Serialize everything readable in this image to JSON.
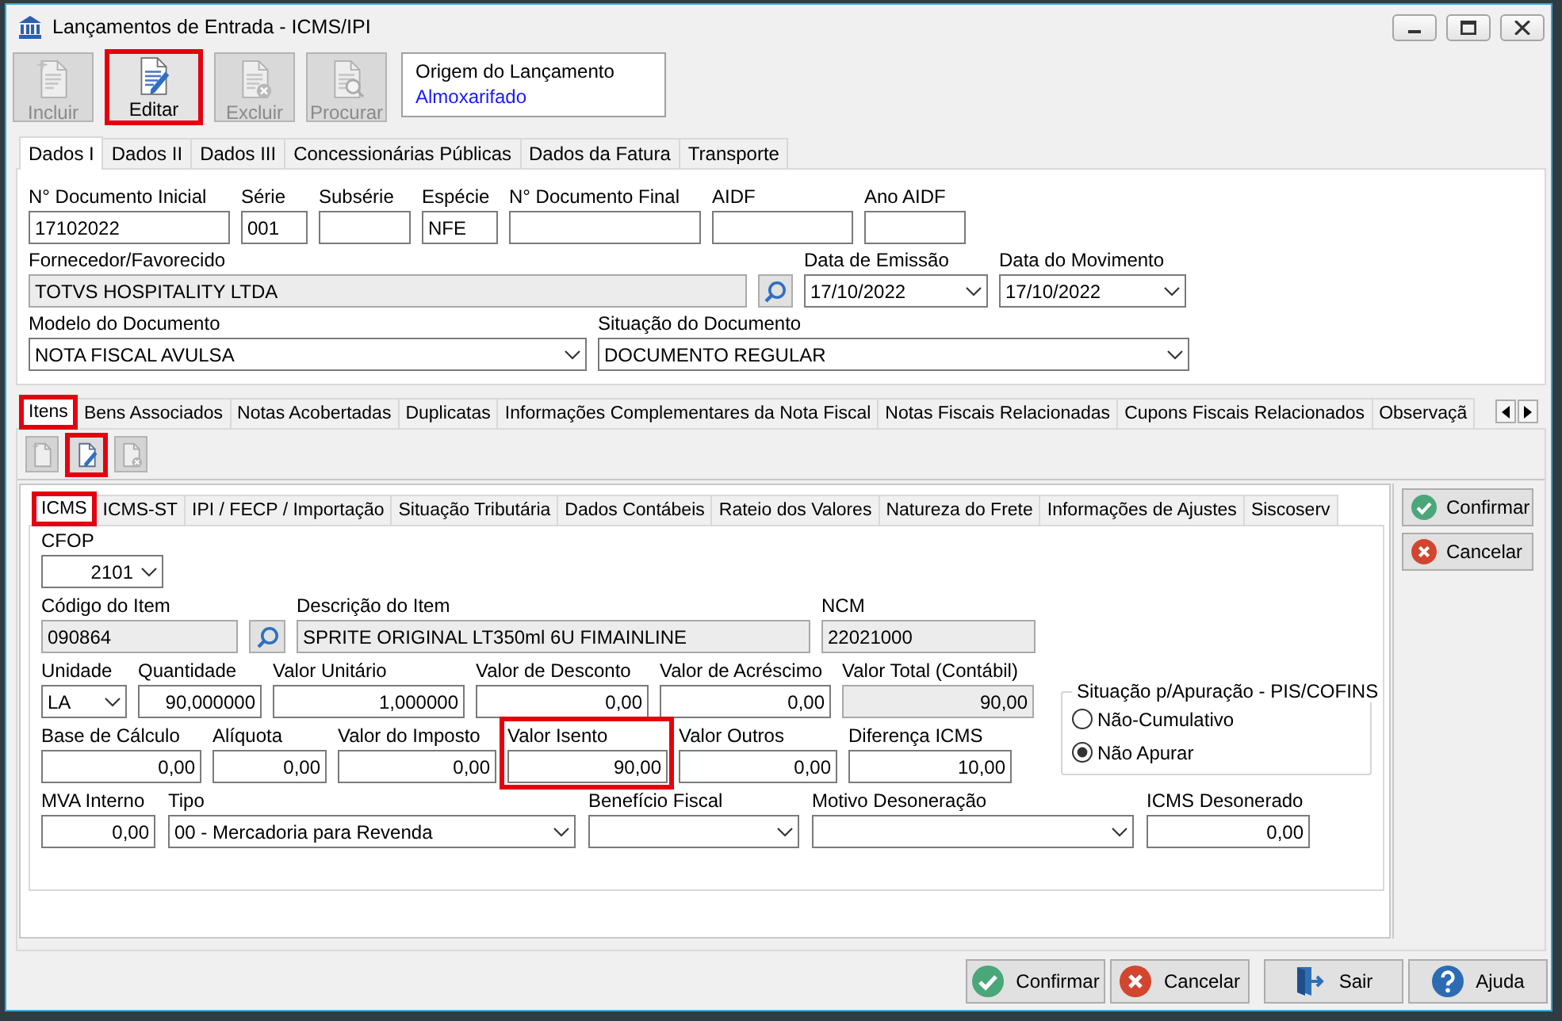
{
  "window": {
    "title": "Lançamentos de Entrada - ICMS/IPI"
  },
  "toolbar": [
    {
      "kind": "new",
      "label": "Incluir",
      "disabled": true,
      "highlighted": false
    },
    {
      "kind": "edit",
      "label": "Editar",
      "disabled": false,
      "highlighted": true
    },
    {
      "kind": "delete",
      "label": "Excluir",
      "disabled": true,
      "highlighted": false
    },
    {
      "kind": "search",
      "label": "Procurar",
      "disabled": true,
      "highlighted": false
    }
  ],
  "origin": {
    "label": "Origem do Lançamento",
    "value": "Almoxarifado"
  },
  "main_tabs": [
    {
      "label": "Dados I",
      "selected": true
    },
    {
      "label": "Dados II",
      "selected": false
    },
    {
      "label": "Dados III",
      "selected": false
    },
    {
      "label": "Concessionárias Públicas",
      "selected": false
    },
    {
      "label": "Dados da Fatura",
      "selected": false
    },
    {
      "label": "Transporte",
      "selected": false
    }
  ],
  "document_rows": [
    [
      {
        "kind": "text",
        "label": "N° Documento Inicial",
        "value": "17102022",
        "read_only": false
      },
      {
        "kind": "text",
        "label": "Série",
        "value": "001",
        "read_only": false
      },
      {
        "kind": "text",
        "label": "Subsérie",
        "read_only": false
      },
      {
        "kind": "text",
        "label": "Espécie",
        "value": "NFE",
        "read_only": false
      },
      {
        "kind": "text",
        "label": "N° Documento Final",
        "read_only": false
      },
      {
        "kind": "text",
        "label": "AIDF",
        "read_only": false
      },
      {
        "kind": "text",
        "label": "Ano AIDF",
        "read_only": false
      }
    ],
    [
      {
        "kind": "text",
        "label": "Fornecedor/Favorecido",
        "value": "TOTVS HOSPITALITY LTDA",
        "read_only": true
      },
      {
        "kind": "lookup"
      },
      {
        "kind": "combo",
        "label": "Data de Emissão",
        "value": "17/10/2022",
        "read_only": false
      },
      {
        "kind": "combo",
        "label": "Data do Movimento",
        "value": "17/10/2022",
        "read_only": false
      }
    ],
    [
      {
        "kind": "combo",
        "label": "Modelo do Documento",
        "value": "NOTA FISCAL AVULSA",
        "read_only": false
      },
      {
        "kind": "combo",
        "label": "Situação do Documento",
        "value": "DOCUMENTO REGULAR",
        "read_only": false
      }
    ]
  ],
  "item_tabs": [
    {
      "label": "Itens",
      "selected": true,
      "highlighted": true
    },
    {
      "label": "Bens Associados",
      "selected": false,
      "highlighted": false
    },
    {
      "label": "Notas Acobertadas",
      "selected": false,
      "highlighted": false
    },
    {
      "label": "Duplicatas",
      "selected": false,
      "highlighted": false
    },
    {
      "label": "Informações Complementares da Nota Fiscal",
      "selected": false,
      "highlighted": false
    },
    {
      "label": "Notas Fiscais Relacionadas",
      "selected": false,
      "highlighted": false
    },
    {
      "label": "Cupons Fiscais Relacionados",
      "selected": false,
      "highlighted": false
    },
    {
      "label": "Observaçã",
      "selected": false,
      "highlighted": false
    }
  ],
  "item_toolbar": [
    {
      "kind": "new",
      "disabled": true,
      "highlighted": false
    },
    {
      "kind": "edit",
      "disabled": false,
      "highlighted": true
    },
    {
      "kind": "delete",
      "disabled": true,
      "highlighted": false
    }
  ],
  "detail_tabs": [
    {
      "label": "ICMS",
      "selected": true,
      "highlighted": true
    },
    {
      "label": "ICMS-ST",
      "selected": false,
      "highlighted": false
    },
    {
      "label": "IPI / FECP / Importação",
      "selected": false,
      "highlighted": false
    },
    {
      "label": "Situação Tributária",
      "selected": false,
      "highlighted": false
    },
    {
      "label": "Dados Contábeis",
      "selected": false,
      "highlighted": false
    },
    {
      "label": "Rateio dos Valores",
      "selected": false,
      "highlighted": false
    },
    {
      "label": "Natureza do Frete",
      "selected": false,
      "highlighted": false
    },
    {
      "label": "Informações de Ajustes",
      "selected": false,
      "highlighted": false
    },
    {
      "label": "Siscoserv",
      "selected": false,
      "highlighted": false
    }
  ],
  "icms_rows": [
    [
      {
        "kind": "numcombo",
        "label": "CFOP",
        "value": "2101",
        "read_only": false,
        "highlighted": false
      }
    ],
    [
      {
        "kind": "text",
        "label": "Código do Item",
        "value": "090864",
        "read_only": true,
        "highlighted": false
      },
      {
        "kind": "lookup"
      },
      {
        "kind": "text",
        "label": "Descrição do Item",
        "value": "SPRITE ORIGINAL LT350ml 6U FIMAINLINE",
        "read_only": true,
        "highlighted": false
      },
      {
        "kind": "text",
        "label": "NCM",
        "value": "22021000",
        "read_only": true,
        "highlighted": false
      }
    ],
    [
      {
        "kind": "combo",
        "label": "Unidade",
        "value": "LA",
        "read_only": false,
        "highlighted": false
      },
      {
        "kind": "number",
        "label": "Quantidade",
        "value": "90,000000",
        "read_only": false,
        "highlighted": false
      },
      {
        "kind": "number",
        "label": "Valor Unitário",
        "value": "1,000000",
        "read_only": false,
        "highlighted": false
      },
      {
        "kind": "number",
        "label": "Valor de Desconto",
        "value": "0,00",
        "read_only": false,
        "highlighted": false
      },
      {
        "kind": "number",
        "label": "Valor de Acréscimo",
        "value": "0,00",
        "read_only": false,
        "highlighted": false
      },
      {
        "kind": "number",
        "label": "Valor Total (Contábil)",
        "value": "90,00",
        "read_only": true,
        "highlighted": false
      }
    ],
    [
      {
        "kind": "number",
        "label": "Base de Cálculo",
        "value": "0,00",
        "read_only": false,
        "highlighted": false
      },
      {
        "kind": "number",
        "label": "Alíquota",
        "value": "0,00",
        "read_only": false,
        "highlighted": false
      },
      {
        "kind": "number",
        "label": "Valor do Imposto",
        "value": "0,00",
        "read_only": false,
        "highlighted": false
      },
      {
        "kind": "number",
        "label": "Valor Isento",
        "value": "90,00",
        "read_only": false,
        "highlighted": true
      },
      {
        "kind": "number",
        "label": "Valor Outros",
        "value": "0,00",
        "read_only": false,
        "highlighted": false
      },
      {
        "kind": "number",
        "label": "Diferença ICMS",
        "value": "10,00",
        "read_only": false,
        "highlighted": false
      }
    ],
    [
      {
        "kind": "number",
        "label": "MVA Interno",
        "value": "0,00",
        "read_only": false,
        "highlighted": false
      },
      {
        "kind": "combo",
        "label": "Tipo",
        "value": "00 - Mercadoria para Revenda",
        "read_only": false,
        "highlighted": false
      },
      {
        "kind": "combo",
        "label": "Benefício Fiscal",
        "read_only": false,
        "highlighted": false
      },
      {
        "kind": "combo",
        "label": "Motivo Desoneração",
        "read_only": false,
        "highlighted": false
      },
      {
        "kind": "number",
        "label": "ICMS Desonerado",
        "value": "0,00",
        "read_only": false,
        "highlighted": false
      }
    ]
  ],
  "pis_cofins": {
    "title": "Situação p/Apuração - PIS/COFINS",
    "options": [
      {
        "label": "Não-Cumulativo",
        "selected": false
      },
      {
        "label": "Não Apurar",
        "selected": true
      }
    ]
  },
  "side_buttons": [
    {
      "kind": "confirm",
      "label": "Confirmar"
    },
    {
      "kind": "cancel",
      "label": "Cancelar"
    }
  ],
  "footer_buttons": [
    {
      "kind": "confirm",
      "label": "Confirmar"
    },
    {
      "kind": "cancel",
      "label": "Cancelar"
    },
    {
      "kind": "exit",
      "label": "Sair"
    },
    {
      "kind": "help",
      "label": "Ajuda"
    }
  ]
}
